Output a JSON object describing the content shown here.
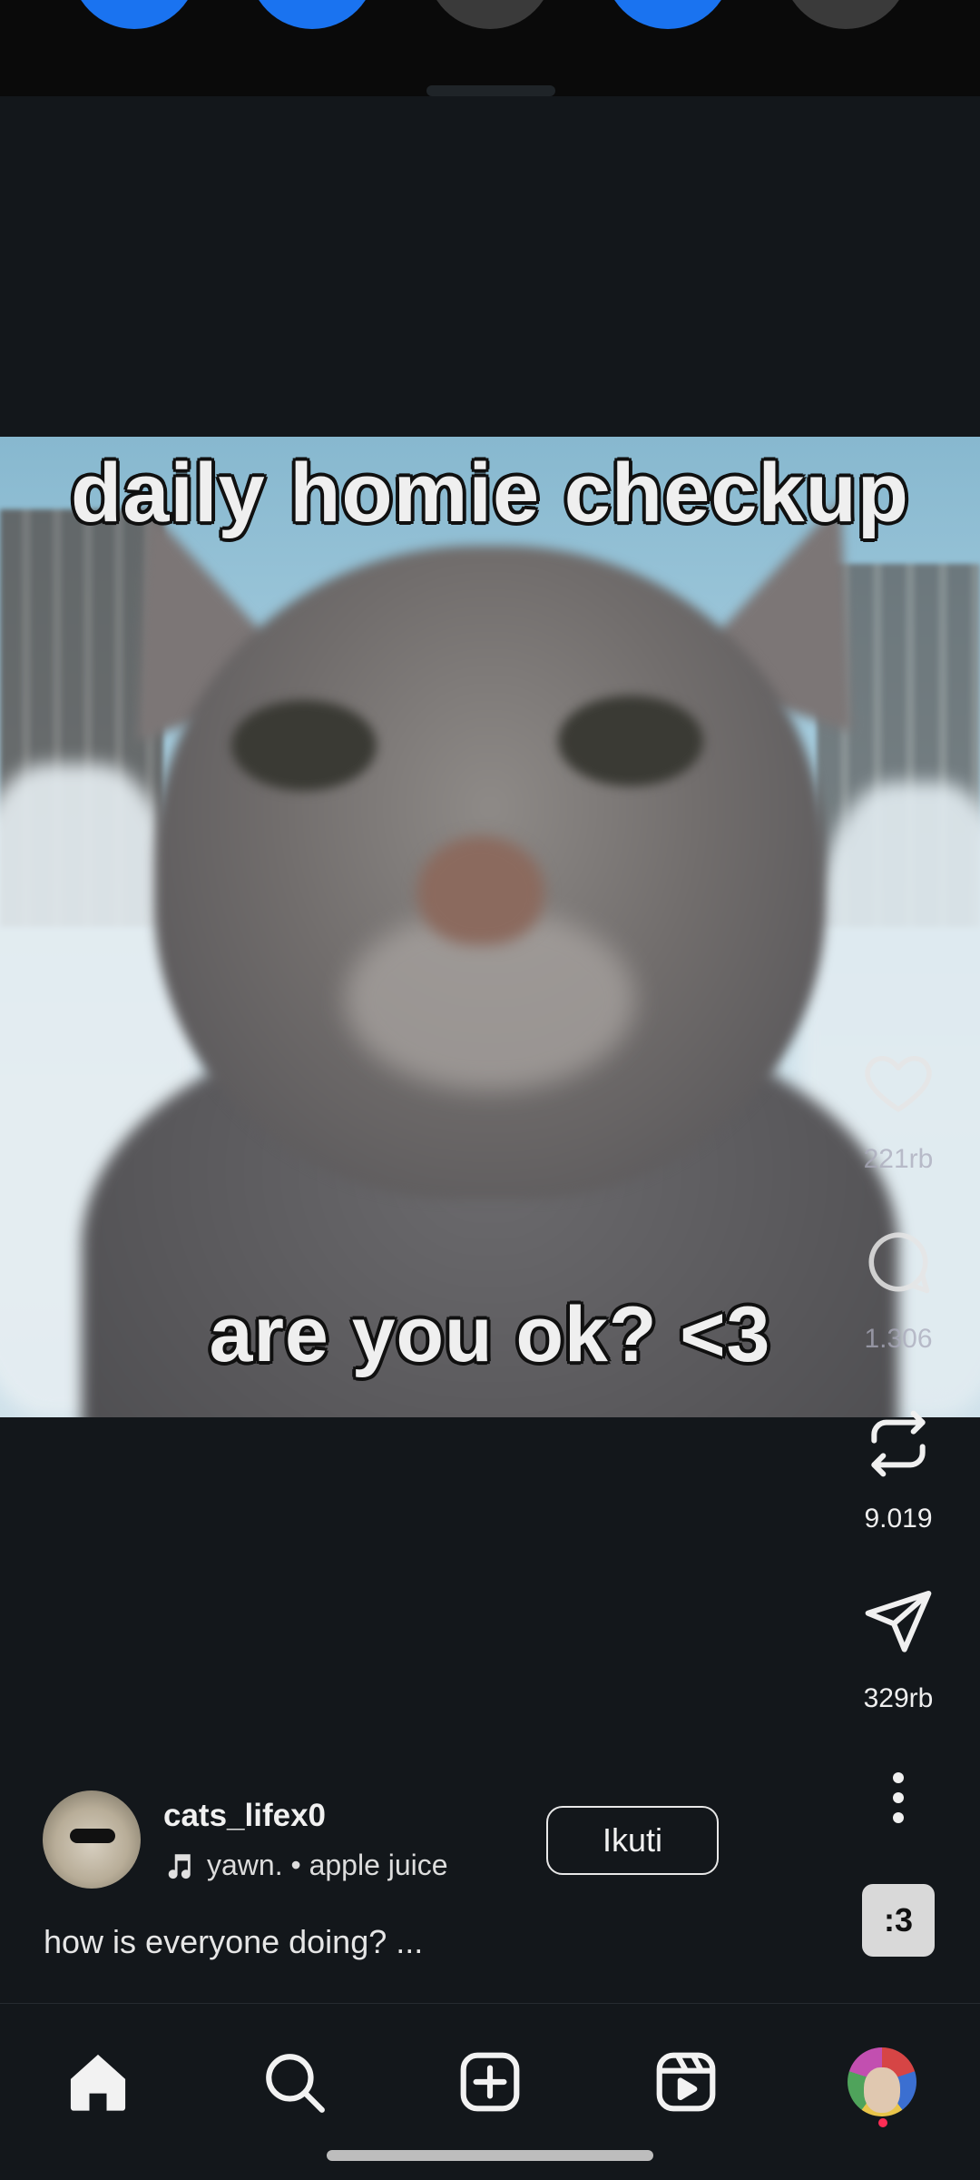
{
  "video": {
    "caption_top": "daily homie checkup",
    "caption_bottom": "are you ok? <3"
  },
  "rail": {
    "like_count": "221rb",
    "comment_count": "1.306",
    "repost_count": "9.019",
    "share_count": "329rb",
    "more_icon": "more-vertical-icon"
  },
  "post": {
    "username": "cats_lifex0",
    "audio": "yawn. • apple juice",
    "follow_label": "Ikuti",
    "caption": "how is everyone doing? ...",
    "sticker_text": ":3"
  },
  "nav": {
    "items": [
      "home-icon",
      "search-icon",
      "create-icon",
      "reels-icon",
      "profile-avatar"
    ]
  },
  "colors": {
    "background": "#13171b",
    "quick_toggle_on": "#1a73f0",
    "quick_toggle_off": "#3a3a3a",
    "notification_dot": "#ff2d55"
  }
}
